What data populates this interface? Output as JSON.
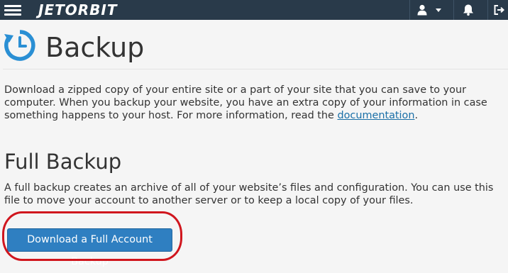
{
  "topbar": {
    "brand": "JETORBIT",
    "colors": {
      "bar": "#293a4a",
      "icon": "#ffffff"
    }
  },
  "icons": {
    "menu": "hamburger-icon",
    "user": "user-icon",
    "caret": "caret-down-icon",
    "notifications": "bell-icon",
    "logout": "logout-icon",
    "page": "backup-clock-icon"
  },
  "page": {
    "title": "Backup",
    "intro_text": "Download a zipped copy of your entire site or a part of your site that you can save to your computer. When you backup your website, you have an extra copy of your information in case something happens to your host. For more information, read the ",
    "intro_link": "documentation",
    "intro_end": "."
  },
  "full_backup": {
    "heading": "Full Backup",
    "description": "A full backup creates an archive of all of your website’s files and configuration. You can use this file to move your account to another server or to keep a local copy of your files.",
    "button_label": "Download a Full Account Backup",
    "button_color": "#2f7fc1",
    "highlight_color": "#d0161e"
  }
}
